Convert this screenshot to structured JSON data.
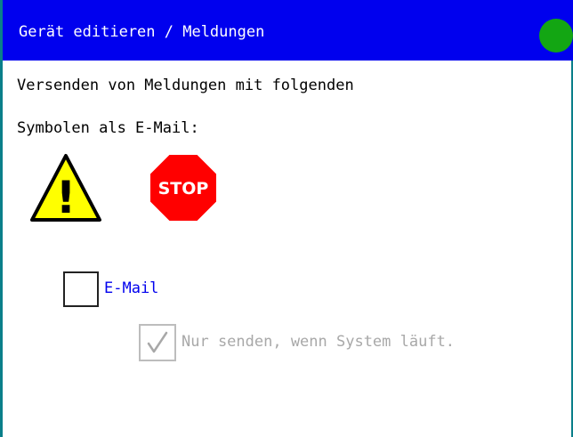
{
  "header": {
    "title": "Gerät editieren / Meldungen",
    "status_color": "#13a613",
    "background_color": "#0000ee"
  },
  "description": {
    "line1": "Versenden von Meldungen mit folgenden",
    "line2": "Symbolen als E-Mail:"
  },
  "symbols": {
    "warning": {
      "icon": "warning-icon",
      "glyph": "!"
    },
    "stop": {
      "icon": "stop-icon",
      "text": "STOP"
    }
  },
  "options": {
    "email": {
      "label": "E-Mail",
      "checked": false,
      "enabled": true
    },
    "only_when_running": {
      "label": "Nur senden, wenn System läuft.",
      "checked": true,
      "enabled": false
    }
  }
}
